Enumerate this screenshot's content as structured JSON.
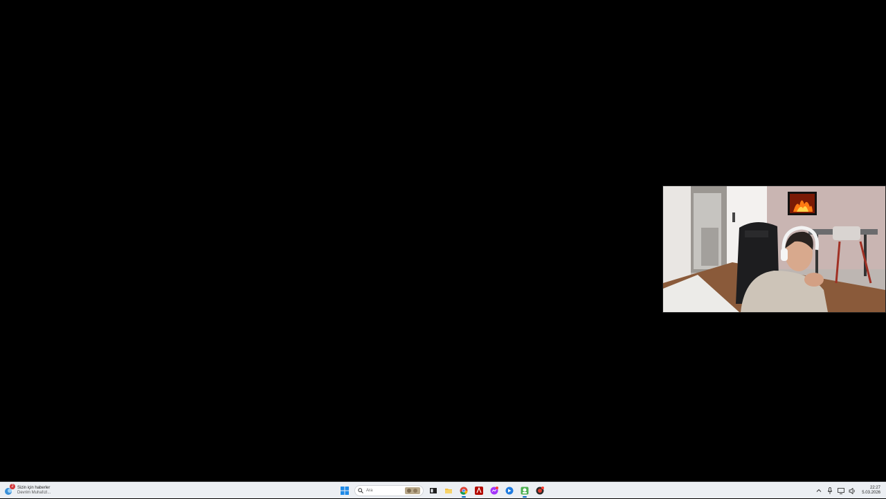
{
  "webcam": {
    "label": "webcam-overlay"
  },
  "taskbar": {
    "widget": {
      "badge": "2",
      "title": "Sizin için haberler",
      "subtitle": "Devrim Muhafızl..."
    },
    "search": {
      "placeholder": "Ara"
    },
    "apps": [
      {
        "name": "file-explorer-icon"
      },
      {
        "name": "folder-icon"
      },
      {
        "name": "chrome-icon"
      },
      {
        "name": "acrobat-icon"
      },
      {
        "name": "messenger-icon"
      },
      {
        "name": "app-blue-icon"
      },
      {
        "name": "app-green-icon"
      },
      {
        "name": "app-red-icon"
      }
    ],
    "clock": {
      "time": "22:27",
      "date": "5.03.2026"
    }
  },
  "colors": {
    "taskbar_bg": "#eceff3",
    "accent": "#0067c0",
    "desktop_bg": "#000000"
  }
}
